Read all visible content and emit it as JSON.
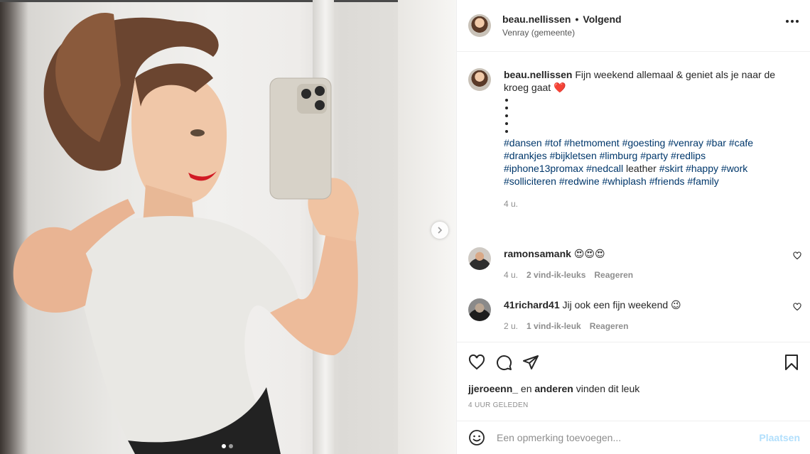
{
  "post_header": {
    "username": "beau.nellissen",
    "separator": "•",
    "follow_label": "Volgend",
    "location": "Venray (gemeente)"
  },
  "caption": {
    "username": "beau.nellissen",
    "text": "Fijn weekend allemaal & geniet als je naar de kroeg gaat",
    "emoji": "❤️",
    "bullet_count": 5,
    "tags_line1": [
      "#dansen",
      "#tof",
      "#hetmoment",
      "#goesting",
      "#venray",
      "#bar",
      "#cafe"
    ],
    "tags_line2": [
      "#drankjes",
      "#bijkletsen",
      "#limburg",
      "#party",
      "#redlips"
    ],
    "tags_line3_a": [
      "#iphone13promax",
      "#nedcall"
    ],
    "tags_line3_word": "leather",
    "tags_line3_b": [
      "#skirt",
      "#happy",
      "#work"
    ],
    "tags_line4": [
      "#solliciteren",
      "#redwine",
      "#whiplash",
      "#friends",
      "#family"
    ],
    "age": "4 u."
  },
  "comments": [
    {
      "username": "ramonsamank",
      "text": "😍😍😍",
      "age": "4 u.",
      "likes": "2 vind-ik-leuks",
      "reply": "Reageren",
      "heart_icon": "heart-outline-icon"
    },
    {
      "username": "41richard41",
      "text": "Jij ook een fijn weekend 😉",
      "age": "2 u.",
      "likes": "1 vind-ik-leuk",
      "reply": "Reageren",
      "heart_icon": "heart-outline-icon"
    }
  ],
  "likes_line": {
    "user": "jjeroeenn_",
    "and": "en",
    "others": "anderen",
    "suffix": "vinden dit leuk"
  },
  "posted": "4 UUR GELEDEN",
  "add_comment": {
    "placeholder": "Een opmerking toevoegen...",
    "post_label": "Plaatsen"
  },
  "carousel": {
    "slides": 2,
    "active_slide": 1
  },
  "colors": {
    "hashtag": "#00376b",
    "muted": "#8e8e8e",
    "post_button_disabled": "#b2dffc"
  }
}
